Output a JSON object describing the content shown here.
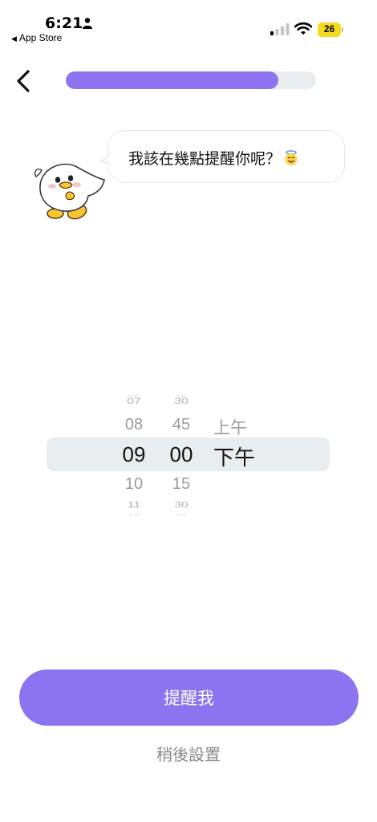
{
  "status_bar": {
    "time": "6:21",
    "back_app": "App Store",
    "battery": "26",
    "battery_color": "#f5db1d"
  },
  "header": {
    "progress": 0.85,
    "accent": "#8c74f0"
  },
  "bubble": {
    "text": "我該在幾點提醒你呢？",
    "emoji": "smiling-face-with-halo"
  },
  "picker": {
    "hours": {
      "far_above": "07",
      "above": "08",
      "selected": "09",
      "below": "10",
      "far_below": "11"
    },
    "minutes": {
      "far_above": "30",
      "above": "45",
      "selected": "00",
      "below": "15",
      "far_below": "30"
    },
    "period": {
      "above": "上午",
      "selected": "下午"
    }
  },
  "actions": {
    "primary": "提醒我",
    "secondary": "稍後設置"
  }
}
